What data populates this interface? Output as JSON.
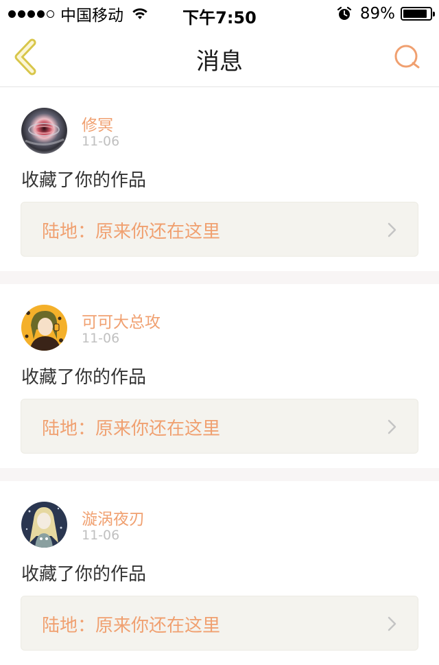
{
  "status_bar": {
    "carrier": "中国移动",
    "time": "下午7:50",
    "battery_percent": "89%",
    "battery_level": 0.89,
    "signal_bars_filled": 4,
    "signal_bars_total": 5
  },
  "nav": {
    "title": "消息",
    "back_icon": "chevron-left-icon",
    "search_icon": "search-icon",
    "accent_color": "#f0a070"
  },
  "notifications": [
    {
      "username": "修冥",
      "date": "11-06",
      "action": "收藏了你的作品",
      "work_title": "陆地：原来你还在这里"
    },
    {
      "username": "可可大总攻",
      "date": "11-06",
      "action": "收藏了你的作品",
      "work_title": "陆地：原来你还在这里"
    },
    {
      "username": "漩涡夜刃",
      "date": "11-06",
      "action": "收藏了你的作品",
      "work_title": "陆地：原来你还在这里"
    }
  ]
}
